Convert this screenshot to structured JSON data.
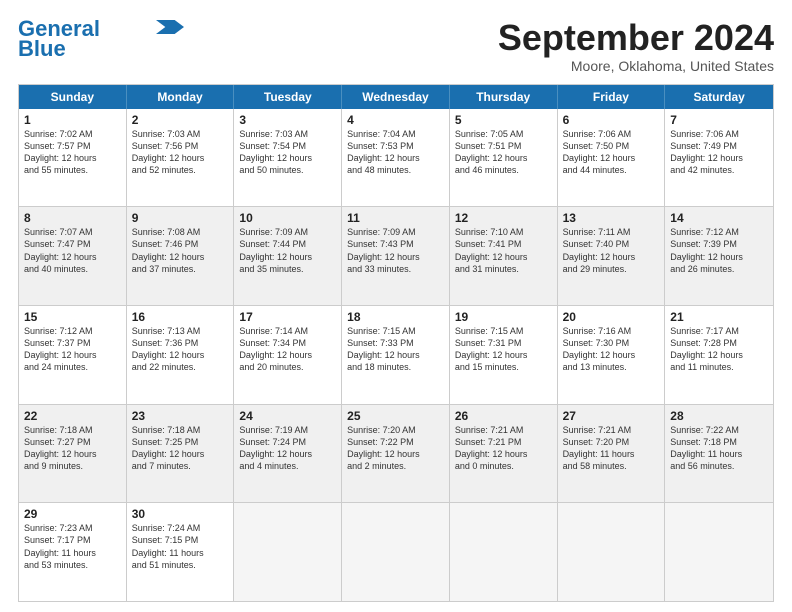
{
  "header": {
    "logo_line1": "General",
    "logo_line2": "Blue",
    "month": "September 2024",
    "location": "Moore, Oklahoma, United States"
  },
  "days_of_week": [
    "Sunday",
    "Monday",
    "Tuesday",
    "Wednesday",
    "Thursday",
    "Friday",
    "Saturday"
  ],
  "rows": [
    [
      {
        "day": "1",
        "lines": [
          "Sunrise: 7:02 AM",
          "Sunset: 7:57 PM",
          "Daylight: 12 hours",
          "and 55 minutes."
        ]
      },
      {
        "day": "2",
        "lines": [
          "Sunrise: 7:03 AM",
          "Sunset: 7:56 PM",
          "Daylight: 12 hours",
          "and 52 minutes."
        ]
      },
      {
        "day": "3",
        "lines": [
          "Sunrise: 7:03 AM",
          "Sunset: 7:54 PM",
          "Daylight: 12 hours",
          "and 50 minutes."
        ]
      },
      {
        "day": "4",
        "lines": [
          "Sunrise: 7:04 AM",
          "Sunset: 7:53 PM",
          "Daylight: 12 hours",
          "and 48 minutes."
        ]
      },
      {
        "day": "5",
        "lines": [
          "Sunrise: 7:05 AM",
          "Sunset: 7:51 PM",
          "Daylight: 12 hours",
          "and 46 minutes."
        ]
      },
      {
        "day": "6",
        "lines": [
          "Sunrise: 7:06 AM",
          "Sunset: 7:50 PM",
          "Daylight: 12 hours",
          "and 44 minutes."
        ]
      },
      {
        "day": "7",
        "lines": [
          "Sunrise: 7:06 AM",
          "Sunset: 7:49 PM",
          "Daylight: 12 hours",
          "and 42 minutes."
        ]
      }
    ],
    [
      {
        "day": "8",
        "lines": [
          "Sunrise: 7:07 AM",
          "Sunset: 7:47 PM",
          "Daylight: 12 hours",
          "and 40 minutes."
        ]
      },
      {
        "day": "9",
        "lines": [
          "Sunrise: 7:08 AM",
          "Sunset: 7:46 PM",
          "Daylight: 12 hours",
          "and 37 minutes."
        ]
      },
      {
        "day": "10",
        "lines": [
          "Sunrise: 7:09 AM",
          "Sunset: 7:44 PM",
          "Daylight: 12 hours",
          "and 35 minutes."
        ]
      },
      {
        "day": "11",
        "lines": [
          "Sunrise: 7:09 AM",
          "Sunset: 7:43 PM",
          "Daylight: 12 hours",
          "and 33 minutes."
        ]
      },
      {
        "day": "12",
        "lines": [
          "Sunrise: 7:10 AM",
          "Sunset: 7:41 PM",
          "Daylight: 12 hours",
          "and 31 minutes."
        ]
      },
      {
        "day": "13",
        "lines": [
          "Sunrise: 7:11 AM",
          "Sunset: 7:40 PM",
          "Daylight: 12 hours",
          "and 29 minutes."
        ]
      },
      {
        "day": "14",
        "lines": [
          "Sunrise: 7:12 AM",
          "Sunset: 7:39 PM",
          "Daylight: 12 hours",
          "and 26 minutes."
        ]
      }
    ],
    [
      {
        "day": "15",
        "lines": [
          "Sunrise: 7:12 AM",
          "Sunset: 7:37 PM",
          "Daylight: 12 hours",
          "and 24 minutes."
        ]
      },
      {
        "day": "16",
        "lines": [
          "Sunrise: 7:13 AM",
          "Sunset: 7:36 PM",
          "Daylight: 12 hours",
          "and 22 minutes."
        ]
      },
      {
        "day": "17",
        "lines": [
          "Sunrise: 7:14 AM",
          "Sunset: 7:34 PM",
          "Daylight: 12 hours",
          "and 20 minutes."
        ]
      },
      {
        "day": "18",
        "lines": [
          "Sunrise: 7:15 AM",
          "Sunset: 7:33 PM",
          "Daylight: 12 hours",
          "and 18 minutes."
        ]
      },
      {
        "day": "19",
        "lines": [
          "Sunrise: 7:15 AM",
          "Sunset: 7:31 PM",
          "Daylight: 12 hours",
          "and 15 minutes."
        ]
      },
      {
        "day": "20",
        "lines": [
          "Sunrise: 7:16 AM",
          "Sunset: 7:30 PM",
          "Daylight: 12 hours",
          "and 13 minutes."
        ]
      },
      {
        "day": "21",
        "lines": [
          "Sunrise: 7:17 AM",
          "Sunset: 7:28 PM",
          "Daylight: 12 hours",
          "and 11 minutes."
        ]
      }
    ],
    [
      {
        "day": "22",
        "lines": [
          "Sunrise: 7:18 AM",
          "Sunset: 7:27 PM",
          "Daylight: 12 hours",
          "and 9 minutes."
        ]
      },
      {
        "day": "23",
        "lines": [
          "Sunrise: 7:18 AM",
          "Sunset: 7:25 PM",
          "Daylight: 12 hours",
          "and 7 minutes."
        ]
      },
      {
        "day": "24",
        "lines": [
          "Sunrise: 7:19 AM",
          "Sunset: 7:24 PM",
          "Daylight: 12 hours",
          "and 4 minutes."
        ]
      },
      {
        "day": "25",
        "lines": [
          "Sunrise: 7:20 AM",
          "Sunset: 7:22 PM",
          "Daylight: 12 hours",
          "and 2 minutes."
        ]
      },
      {
        "day": "26",
        "lines": [
          "Sunrise: 7:21 AM",
          "Sunset: 7:21 PM",
          "Daylight: 12 hours",
          "and 0 minutes."
        ]
      },
      {
        "day": "27",
        "lines": [
          "Sunrise: 7:21 AM",
          "Sunset: 7:20 PM",
          "Daylight: 11 hours",
          "and 58 minutes."
        ]
      },
      {
        "day": "28",
        "lines": [
          "Sunrise: 7:22 AM",
          "Sunset: 7:18 PM",
          "Daylight: 11 hours",
          "and 56 minutes."
        ]
      }
    ],
    [
      {
        "day": "29",
        "lines": [
          "Sunrise: 7:23 AM",
          "Sunset: 7:17 PM",
          "Daylight: 11 hours",
          "and 53 minutes."
        ]
      },
      {
        "day": "30",
        "lines": [
          "Sunrise: 7:24 AM",
          "Sunset: 7:15 PM",
          "Daylight: 11 hours",
          "and 51 minutes."
        ]
      },
      {
        "day": "",
        "lines": []
      },
      {
        "day": "",
        "lines": []
      },
      {
        "day": "",
        "lines": []
      },
      {
        "day": "",
        "lines": []
      },
      {
        "day": "",
        "lines": []
      }
    ]
  ]
}
